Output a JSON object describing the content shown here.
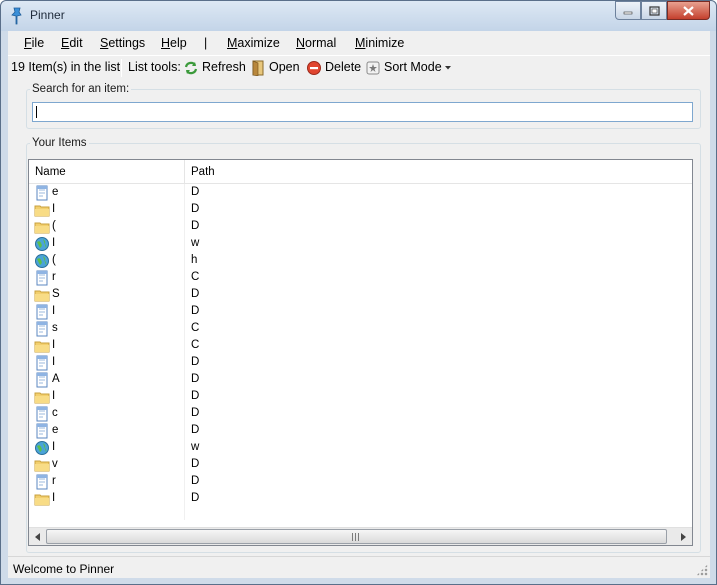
{
  "window": {
    "title": "Pinner"
  },
  "menu": {
    "file": "File",
    "edit": "Edit",
    "settings": "Settings",
    "help": "Help",
    "divider": "|",
    "maximize": "Maximize",
    "normal": "Normal",
    "minimize": "Minimize"
  },
  "toolbar": {
    "count": "19 Item(s) in the list",
    "list_tools": "List tools:",
    "refresh": "Refresh",
    "open": "Open",
    "delete": "Delete",
    "sort_mode": "Sort Mode"
  },
  "search": {
    "label": "Search for an item:",
    "value": ""
  },
  "items_group": {
    "label": "Your Items"
  },
  "list": {
    "columns": {
      "name": "Name",
      "path": "Path"
    },
    "rows": [
      {
        "icon": "file-icon",
        "name": "e",
        "path": "D"
      },
      {
        "icon": "folder-icon",
        "name": "I",
        "path": "D"
      },
      {
        "icon": "folder-icon",
        "name": "(",
        "path": "D"
      },
      {
        "icon": "globe-icon",
        "name": "I",
        "path": "w"
      },
      {
        "icon": "globe-icon",
        "name": "(",
        "path": "h"
      },
      {
        "icon": "file-icon",
        "name": "r",
        "path": "C"
      },
      {
        "icon": "folder-icon",
        "name": "S",
        "path": "D"
      },
      {
        "icon": "file-icon",
        "name": "I",
        "path": "D"
      },
      {
        "icon": "file-icon",
        "name": "s",
        "path": "C"
      },
      {
        "icon": "folder-icon",
        "name": "I",
        "path": "C"
      },
      {
        "icon": "file-icon",
        "name": "I",
        "path": "D"
      },
      {
        "icon": "file-icon",
        "name": "A",
        "path": "D"
      },
      {
        "icon": "folder-icon",
        "name": "I",
        "path": "D"
      },
      {
        "icon": "file-icon",
        "name": "c",
        "path": "D"
      },
      {
        "icon": "file-icon",
        "name": "e",
        "path": "D"
      },
      {
        "icon": "globe-icon",
        "name": "I",
        "path": "w"
      },
      {
        "icon": "folder-icon",
        "name": "v",
        "path": "D"
      },
      {
        "icon": "file-icon",
        "name": "r",
        "path": "D"
      },
      {
        "icon": "folder-icon",
        "name": "I",
        "path": "D"
      }
    ]
  },
  "status": {
    "text": "Welcome to Pinner"
  },
  "colors": {
    "selection_border": "#7ea7cf",
    "title_gradient_top": "#dde8f4",
    "close_button": "#c4402d"
  }
}
